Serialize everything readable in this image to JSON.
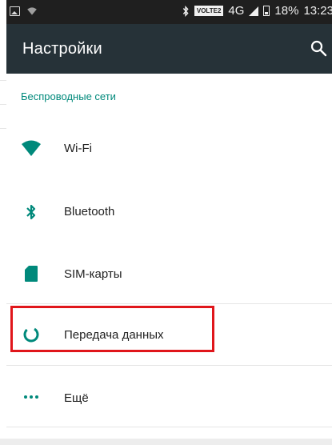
{
  "status_bar": {
    "volte": "VOLTE2",
    "network": "4G",
    "battery": "18%",
    "time": "13:23"
  },
  "toolbar": {
    "title": "Настройки"
  },
  "section": {
    "header": "Беспроводные сети"
  },
  "items": [
    {
      "label": "Wi-Fi",
      "icon": "wifi-icon"
    },
    {
      "label": "Bluetooth",
      "icon": "bluetooth-icon"
    },
    {
      "label": "SIM-карты",
      "icon": "sim-card-icon"
    },
    {
      "label": "Передача данных",
      "icon": "data-usage-icon"
    },
    {
      "label": "Ещё",
      "icon": "more-icon"
    }
  ],
  "colors": {
    "toolbar": "#263238",
    "accent": "#00897b",
    "highlight": "#e0161b"
  }
}
